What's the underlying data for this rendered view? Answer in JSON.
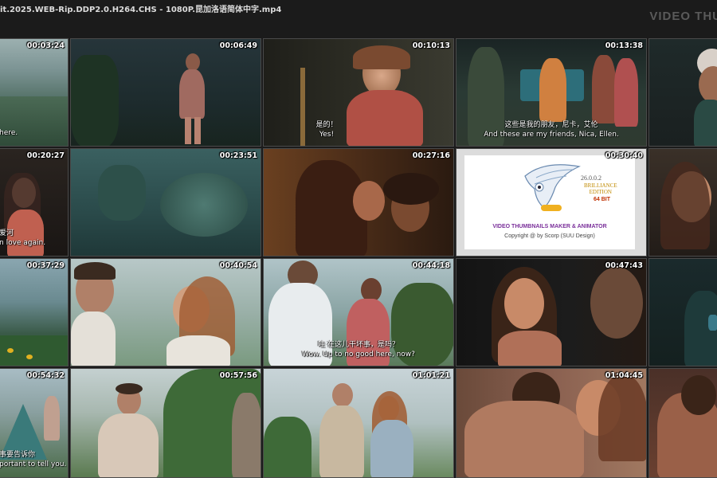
{
  "header": {
    "file_title": "it.2025.WEB-Rip.DDP2.0.H264.CHS - 1080P.昆加洛语简体中字.mp4",
    "watermark": "VIDEO THU"
  },
  "thumbnails": [
    {
      "ts": "00:03:24",
      "subs": [
        "here."
      ]
    },
    {
      "ts": "00:06:49",
      "subs": []
    },
    {
      "ts": "00:10:13",
      "subs": [
        "是的！",
        "Yes!"
      ]
    },
    {
      "ts": "00:13:38",
      "subs": [
        "这些是我的朋友，尼卡，艾伦",
        "And these are my friends, Nica, Ellen."
      ]
    },
    {
      "ts": "",
      "subs": []
    },
    {
      "ts": "00:20:27",
      "subs": [
        "爱河",
        "n love again."
      ]
    },
    {
      "ts": "00:23:51",
      "subs": []
    },
    {
      "ts": "00:27:16",
      "subs": []
    },
    {
      "ts": "00:30:40",
      "subs": []
    },
    {
      "ts": "",
      "subs": []
    },
    {
      "ts": "00:37:29",
      "subs": []
    },
    {
      "ts": "00:40:54",
      "subs": []
    },
    {
      "ts": "00:44:18",
      "subs": [
        "哇 在这儿干坏事，是吗？",
        "Wow. Up to no good here, now?"
      ]
    },
    {
      "ts": "00:47:43",
      "subs": []
    },
    {
      "ts": "",
      "subs": []
    },
    {
      "ts": "00:54:32",
      "subs": [
        "事要告诉你",
        "portant to tell you."
      ]
    },
    {
      "ts": "00:57:56",
      "subs": []
    },
    {
      "ts": "01:01:21",
      "subs": []
    },
    {
      "ts": "01:04:45",
      "subs": []
    },
    {
      "ts": "",
      "subs": []
    }
  ],
  "logo": {
    "version": "26.0.0.2",
    "edition": "BRILLIANCE\nEDITION",
    "bits": "64 BIT",
    "title": "VIDEO THUMBNAILS MAKER & ANIMATOR",
    "copyright": "Copyright @ by Scorp (SUU Design)"
  },
  "colors": {
    "background": "#1b1b1b",
    "thumb_border": "#4a4a4a",
    "logo_title": "#7a2f9a"
  }
}
